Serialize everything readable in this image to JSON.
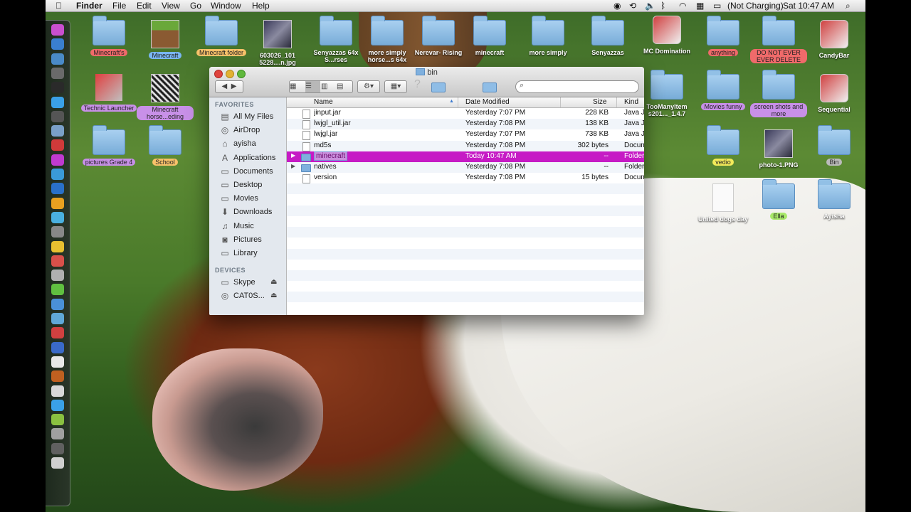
{
  "menubar": {
    "items": [
      "Finder",
      "File",
      "Edit",
      "View",
      "Go",
      "Window",
      "Help"
    ],
    "battery_status": "(Not Charging)",
    "clock": "Sat 10:47 AM"
  },
  "desktop_icons": [
    {
      "label": "Minecraft's",
      "kind": "folder",
      "tag_color": "#f06a6a"
    },
    {
      "label": "Minecraft",
      "kind": "grass-block",
      "tag_color": "#7ab6f2"
    },
    {
      "label": "Minecraft folder",
      "kind": "folder",
      "tag_color": "#f8c26a"
    },
    {
      "label": "603026_101 5228....n.jpg",
      "kind": "image",
      "tag_color": ""
    },
    {
      "label": "Senyazzas 64x S...rses",
      "kind": "folder",
      "tag_color": ""
    },
    {
      "label": "more simply horse...s 64x",
      "kind": "folder",
      "tag_color": ""
    },
    {
      "label": "Nerevar- Rising",
      "kind": "folder",
      "tag_color": ""
    },
    {
      "label": "minecraft",
      "kind": "folder",
      "tag_color": ""
    },
    {
      "label": "more simply",
      "kind": "folder",
      "tag_color": ""
    },
    {
      "label": "Senyazzas",
      "kind": "folder",
      "tag_color": ""
    },
    {
      "label": "MC Domination",
      "kind": "app",
      "tag_color": ""
    },
    {
      "label": "anything",
      "kind": "folder",
      "tag_color": "#f06a6a"
    },
    {
      "label": "DO NOT EVER EVER DELETE",
      "kind": "folder",
      "tag_color": "#f06a6a"
    },
    {
      "label": "CandyBar",
      "kind": "app",
      "tag_color": ""
    },
    {
      "label": "Technic Launcher",
      "kind": "tools",
      "tag_color": "#c890e8"
    },
    {
      "label": "Minecraft horse...eding",
      "kind": "doc",
      "tag_color": "#c890e8"
    },
    {
      "label": "TooManyItem s201..._1.4.7",
      "kind": "folder",
      "tag_color": ""
    },
    {
      "label": "Movies funny",
      "kind": "folder",
      "tag_color": "#c890e8"
    },
    {
      "label": "screen shots and more",
      "kind": "folder",
      "tag_color": "#c890e8"
    },
    {
      "label": "Sequential",
      "kind": "app",
      "tag_color": ""
    },
    {
      "label": "pictures Grade 4",
      "kind": "folder",
      "tag_color": "#c890e8"
    },
    {
      "label": "School",
      "kind": "folder",
      "tag_color": "#f8c26a"
    },
    {
      "label": "vedio",
      "kind": "folder",
      "tag_color": "#f2ea5a"
    },
    {
      "label": "photo-1.PNG",
      "kind": "image",
      "tag_color": ""
    },
    {
      "label": "Bin",
      "kind": "folder",
      "tag_color": "#bbbbbb"
    },
    {
      "label": "United dogs day",
      "kind": "rtf",
      "tag_color": ""
    },
    {
      "label": "Ella",
      "kind": "folder",
      "tag_color": "#a8e86a"
    },
    {
      "label": "Ayisha",
      "kind": "folder",
      "tag_color": ""
    }
  ],
  "finder": {
    "title": "bin",
    "search_placeholder": "",
    "sidebar": {
      "favorites_header": "FAVORITES",
      "favorites": [
        {
          "label": "All My Files",
          "icon": "files-icon"
        },
        {
          "label": "AirDrop",
          "icon": "airdrop-icon"
        },
        {
          "label": "ayisha",
          "icon": "home-icon"
        },
        {
          "label": "Applications",
          "icon": "applications-icon"
        },
        {
          "label": "Documents",
          "icon": "documents-icon"
        },
        {
          "label": "Desktop",
          "icon": "desktop-icon"
        },
        {
          "label": "Movies",
          "icon": "movies-icon"
        },
        {
          "label": "Downloads",
          "icon": "downloads-icon"
        },
        {
          "label": "Music",
          "icon": "music-icon"
        },
        {
          "label": "Pictures",
          "icon": "pictures-icon"
        },
        {
          "label": "Library",
          "icon": "folder-icon"
        }
      ],
      "devices_header": "DEVICES",
      "devices": [
        {
          "label": "Skype",
          "icon": "disk-icon",
          "eject": "⏏"
        },
        {
          "label": "CAT0S...",
          "icon": "cd-icon",
          "eject": "⏏"
        }
      ]
    },
    "columns": {
      "name": "Name",
      "date": "Date Modified",
      "size": "Size",
      "kind": "Kind"
    },
    "files": [
      {
        "name": "jinput.jar",
        "date": "Yesterday 7:07 PM",
        "size": "228 KB",
        "kind": "Java JAR",
        "type": "file",
        "selected": false
      },
      {
        "name": "lwjgl_util.jar",
        "date": "Yesterday 7:08 PM",
        "size": "138 KB",
        "kind": "Java JAR",
        "type": "file",
        "selected": false
      },
      {
        "name": "lwjgl.jar",
        "date": "Yesterday 7:07 PM",
        "size": "738 KB",
        "kind": "Java JAR",
        "type": "file",
        "selected": false
      },
      {
        "name": "md5s",
        "date": "Yesterday 7:08 PM",
        "size": "302 bytes",
        "kind": "Document",
        "type": "file",
        "selected": false
      },
      {
        "name": "minecraft",
        "date": "Today 10:47 AM",
        "size": "--",
        "kind": "Folder",
        "type": "folder",
        "selected": true
      },
      {
        "name": "natives",
        "date": "Yesterday 7:08 PM",
        "size": "--",
        "kind": "Folder",
        "type": "folder",
        "selected": false
      },
      {
        "name": "version",
        "date": "Yesterday 7:08 PM",
        "size": "15 bytes",
        "kind": "Document",
        "type": "file",
        "selected": false
      }
    ]
  }
}
